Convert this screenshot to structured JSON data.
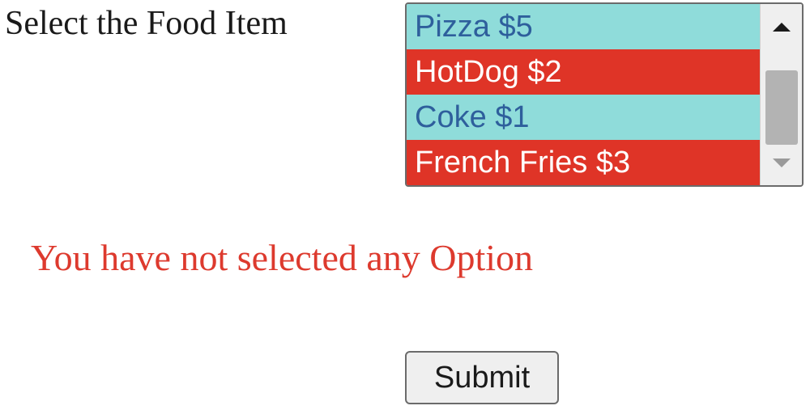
{
  "form": {
    "select_label": "Select the Food Item",
    "options": [
      {
        "label": "Pizza $5"
      },
      {
        "label": "HotDog $2"
      },
      {
        "label": "Coke $1"
      },
      {
        "label": "French Fries $3"
      }
    ],
    "submit_label": "Submit"
  },
  "status": {
    "message": "You have not selected any Option",
    "message_color": "#dd3a2e"
  },
  "colors": {
    "option_alt_a_bg": "#8fdcda",
    "option_alt_a_text": "#2e5f9c",
    "option_alt_b_bg": "#df3427",
    "option_alt_b_text": "#ffffff"
  },
  "icons": {
    "scroll_up": "triangle-up-icon",
    "scroll_down": "triangle-down-icon"
  }
}
